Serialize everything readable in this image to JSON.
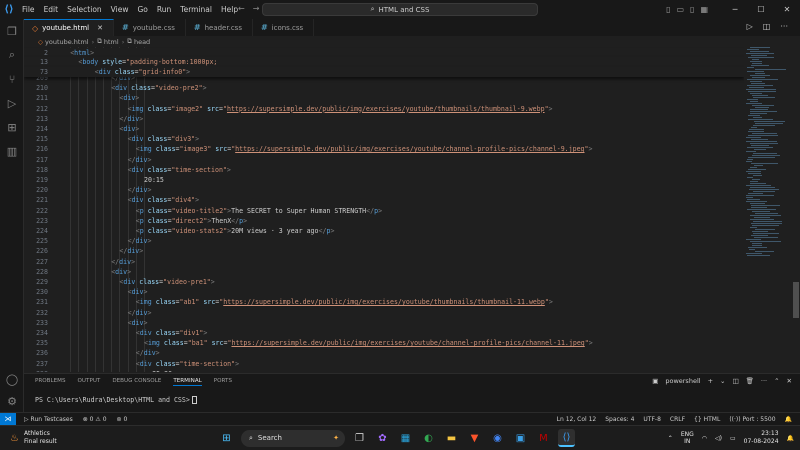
{
  "window": {
    "menu": [
      "File",
      "Edit",
      "Selection",
      "View",
      "Go",
      "Run",
      "Terminal",
      "Help"
    ],
    "search_text": "HTML and CSS"
  },
  "tabs": [
    {
      "label": "youtube.html",
      "type": "html",
      "active": true
    },
    {
      "label": "youtube.css",
      "type": "css",
      "active": false
    },
    {
      "label": "header.css",
      "type": "css",
      "active": false
    },
    {
      "label": "icons.css",
      "type": "css",
      "active": false
    }
  ],
  "breadcrumb": [
    "youtube.html",
    "html",
    "head"
  ],
  "editor": {
    "sticky_lines": [
      {
        "n": "2",
        "indent": 1,
        "tokens": [
          [
            "br",
            "<"
          ],
          [
            "tg",
            "html"
          ],
          [
            "br",
            ">"
          ]
        ]
      },
      {
        "n": "13",
        "indent": 2,
        "tokens": [
          [
            "br",
            "<"
          ],
          [
            "tg",
            "body"
          ],
          [
            "tx",
            " "
          ],
          [
            "at",
            "style"
          ],
          [
            "tx",
            "="
          ],
          [
            "st",
            "\"padding-bottom:1000px;"
          ]
        ]
      },
      {
        "n": "73",
        "indent": 4,
        "tokens": [
          [
            "br",
            "<"
          ],
          [
            "tg",
            "div"
          ],
          [
            "tx",
            " "
          ],
          [
            "at",
            "class"
          ],
          [
            "tx",
            "="
          ],
          [
            "st",
            "\"grid-info0\""
          ],
          [
            "br",
            ">"
          ]
        ]
      }
    ],
    "lines": [
      {
        "n": "209",
        "indent": 6,
        "tokens": [
          [
            "br",
            "</"
          ],
          [
            "tg",
            "div"
          ],
          [
            "br",
            ">"
          ]
        ]
      },
      {
        "n": "210",
        "indent": 6,
        "tokens": [
          [
            "br",
            "<"
          ],
          [
            "tg",
            "div"
          ],
          [
            "tx",
            " "
          ],
          [
            "at",
            "class"
          ],
          [
            "tx",
            "="
          ],
          [
            "st",
            "\"video-pre2\""
          ],
          [
            "br",
            ">"
          ]
        ]
      },
      {
        "n": "211",
        "indent": 7,
        "tokens": [
          [
            "br",
            "<"
          ],
          [
            "tg",
            "div"
          ],
          [
            "br",
            ">"
          ]
        ]
      },
      {
        "n": "212",
        "indent": 8,
        "tokens": [
          [
            "br",
            "<"
          ],
          [
            "tg",
            "img"
          ],
          [
            "tx",
            " "
          ],
          [
            "at",
            "class"
          ],
          [
            "tx",
            "="
          ],
          [
            "st",
            "\"image2\""
          ],
          [
            "tx",
            " "
          ],
          [
            "at",
            "src"
          ],
          [
            "tx",
            "="
          ],
          [
            "st",
            "\""
          ],
          [
            "stu",
            "https://supersimple.dev/public/img/exercises/youtube/thumbnails/thumbnail-9.webp"
          ],
          [
            "st",
            "\""
          ],
          [
            "br",
            ">"
          ]
        ]
      },
      {
        "n": "213",
        "indent": 7,
        "tokens": [
          [
            "br",
            "</"
          ],
          [
            "tg",
            "div"
          ],
          [
            "br",
            ">"
          ]
        ]
      },
      {
        "n": "214",
        "indent": 7,
        "tokens": [
          [
            "br",
            "<"
          ],
          [
            "tg",
            "div"
          ],
          [
            "br",
            ">"
          ]
        ]
      },
      {
        "n": "215",
        "indent": 8,
        "tokens": [
          [
            "br",
            "<"
          ],
          [
            "tg",
            "div"
          ],
          [
            "tx",
            " "
          ],
          [
            "at",
            "class"
          ],
          [
            "tx",
            "="
          ],
          [
            "st",
            "\"div3\""
          ],
          [
            "br",
            ">"
          ]
        ]
      },
      {
        "n": "216",
        "indent": 9,
        "tokens": [
          [
            "br",
            "<"
          ],
          [
            "tg",
            "img"
          ],
          [
            "tx",
            " "
          ],
          [
            "at",
            "class"
          ],
          [
            "tx",
            "="
          ],
          [
            "st",
            "\"image3\""
          ],
          [
            "tx",
            " "
          ],
          [
            "at",
            "src"
          ],
          [
            "tx",
            "="
          ],
          [
            "st",
            "\""
          ],
          [
            "stu",
            "https://supersimple.dev/public/img/exercises/youtube/channel-profile-pics/channel-9.jpeg"
          ],
          [
            "st",
            "\""
          ],
          [
            "br",
            ">"
          ]
        ]
      },
      {
        "n": "217",
        "indent": 8,
        "tokens": [
          [
            "br",
            "</"
          ],
          [
            "tg",
            "div"
          ],
          [
            "br",
            ">"
          ]
        ]
      },
      {
        "n": "218",
        "indent": 8,
        "tokens": [
          [
            "br",
            "<"
          ],
          [
            "tg",
            "div"
          ],
          [
            "tx",
            " "
          ],
          [
            "at",
            "class"
          ],
          [
            "tx",
            "="
          ],
          [
            "st",
            "\"time-section\""
          ],
          [
            "br",
            ">"
          ]
        ]
      },
      {
        "n": "219",
        "indent": 10,
        "tokens": [
          [
            "tx",
            "20:15"
          ]
        ]
      },
      {
        "n": "220",
        "indent": 8,
        "tokens": [
          [
            "br",
            "</"
          ],
          [
            "tg",
            "div"
          ],
          [
            "br",
            ">"
          ]
        ]
      },
      {
        "n": "221",
        "indent": 8,
        "tokens": [
          [
            "br",
            "<"
          ],
          [
            "tg",
            "div"
          ],
          [
            "tx",
            " "
          ],
          [
            "at",
            "class"
          ],
          [
            "tx",
            "="
          ],
          [
            "st",
            "\"div4\""
          ],
          [
            "br",
            ">"
          ]
        ]
      },
      {
        "n": "222",
        "indent": 9,
        "tokens": [
          [
            "br",
            "<"
          ],
          [
            "tg",
            "p"
          ],
          [
            "tx",
            " "
          ],
          [
            "at",
            "class"
          ],
          [
            "tx",
            "="
          ],
          [
            "st",
            "\"video-title2\""
          ],
          [
            "br",
            ">"
          ],
          [
            "tx",
            "The SECRET to Super Human STRENGTH"
          ],
          [
            "br",
            "</"
          ],
          [
            "tg",
            "p"
          ],
          [
            "br",
            ">"
          ]
        ]
      },
      {
        "n": "223",
        "indent": 9,
        "tokens": [
          [
            "br",
            "<"
          ],
          [
            "tg",
            "p"
          ],
          [
            "tx",
            " "
          ],
          [
            "at",
            "class"
          ],
          [
            "tx",
            "="
          ],
          [
            "st",
            "\"direct2\""
          ],
          [
            "br",
            ">"
          ],
          [
            "tx",
            "ThenX"
          ],
          [
            "br",
            "</"
          ],
          [
            "tg",
            "p"
          ],
          [
            "br",
            ">"
          ]
        ]
      },
      {
        "n": "224",
        "indent": 9,
        "tokens": [
          [
            "br",
            "<"
          ],
          [
            "tg",
            "p"
          ],
          [
            "tx",
            " "
          ],
          [
            "at",
            "class"
          ],
          [
            "tx",
            "="
          ],
          [
            "st",
            "\"video-stats2\""
          ],
          [
            "br",
            ">"
          ],
          [
            "tx",
            "20M views · 3 year ago"
          ],
          [
            "br",
            "</"
          ],
          [
            "tg",
            "p"
          ],
          [
            "br",
            ">"
          ]
        ]
      },
      {
        "n": "225",
        "indent": 8,
        "tokens": [
          [
            "br",
            "</"
          ],
          [
            "tg",
            "div"
          ],
          [
            "br",
            ">"
          ]
        ]
      },
      {
        "n": "226",
        "indent": 7,
        "tokens": [
          [
            "br",
            "</"
          ],
          [
            "tg",
            "div"
          ],
          [
            "br",
            ">"
          ]
        ]
      },
      {
        "n": "227",
        "indent": 6,
        "tokens": [
          [
            "br",
            "</"
          ],
          [
            "tg",
            "div"
          ],
          [
            "br",
            ">"
          ]
        ]
      },
      {
        "n": "228",
        "indent": 6,
        "tokens": [
          [
            "br",
            "<"
          ],
          [
            "tg",
            "div"
          ],
          [
            "br",
            ">"
          ]
        ]
      },
      {
        "n": "229",
        "indent": 7,
        "tokens": [
          [
            "br",
            "<"
          ],
          [
            "tg",
            "div"
          ],
          [
            "tx",
            " "
          ],
          [
            "at",
            "class"
          ],
          [
            "tx",
            "="
          ],
          [
            "st",
            "\"video-pre1\""
          ],
          [
            "br",
            ">"
          ]
        ]
      },
      {
        "n": "230",
        "indent": 8,
        "tokens": [
          [
            "br",
            "<"
          ],
          [
            "tg",
            "div"
          ],
          [
            "br",
            ">"
          ]
        ]
      },
      {
        "n": "231",
        "indent": 9,
        "tokens": [
          [
            "br",
            "<"
          ],
          [
            "tg",
            "img"
          ],
          [
            "tx",
            " "
          ],
          [
            "at",
            "class"
          ],
          [
            "tx",
            "="
          ],
          [
            "st",
            "\"ab1\""
          ],
          [
            "tx",
            " "
          ],
          [
            "at",
            "src"
          ],
          [
            "tx",
            "="
          ],
          [
            "st",
            "\""
          ],
          [
            "stu",
            "https://supersimple.dev/public/img/exercises/youtube/thumbnails/thumbnail-11.webp"
          ],
          [
            "st",
            "\""
          ],
          [
            "br",
            ">"
          ]
        ]
      },
      {
        "n": "232",
        "indent": 8,
        "tokens": [
          [
            "br",
            "</"
          ],
          [
            "tg",
            "div"
          ],
          [
            "br",
            ">"
          ]
        ]
      },
      {
        "n": "233",
        "indent": 8,
        "tokens": [
          [
            "br",
            "<"
          ],
          [
            "tg",
            "div"
          ],
          [
            "br",
            ">"
          ]
        ]
      },
      {
        "n": "234",
        "indent": 9,
        "tokens": [
          [
            "br",
            "<"
          ],
          [
            "tg",
            "div"
          ],
          [
            "tx",
            " "
          ],
          [
            "at",
            "class"
          ],
          [
            "tx",
            "="
          ],
          [
            "st",
            "\"div1\""
          ],
          [
            "br",
            ">"
          ]
        ]
      },
      {
        "n": "235",
        "indent": 10,
        "tokens": [
          [
            "br",
            "<"
          ],
          [
            "tg",
            "img"
          ],
          [
            "tx",
            " "
          ],
          [
            "at",
            "class"
          ],
          [
            "tx",
            "="
          ],
          [
            "st",
            "\"ba1\""
          ],
          [
            "tx",
            " "
          ],
          [
            "at",
            "src"
          ],
          [
            "tx",
            "="
          ],
          [
            "st",
            "\""
          ],
          [
            "stu",
            "https://supersimple.dev/public/img/exercises/youtube/channel-profile-pics/channel-11.jpeg"
          ],
          [
            "st",
            "\""
          ],
          [
            "br",
            ">"
          ]
        ]
      },
      {
        "n": "236",
        "indent": 9,
        "tokens": [
          [
            "br",
            "</"
          ],
          [
            "tg",
            "div"
          ],
          [
            "br",
            ">"
          ]
        ]
      },
      {
        "n": "237",
        "indent": 9,
        "tokens": [
          [
            "br",
            "<"
          ],
          [
            "tg",
            "div"
          ],
          [
            "tx",
            " "
          ],
          [
            "at",
            "class"
          ],
          [
            "tx",
            "="
          ],
          [
            "st",
            "\"time-section\""
          ],
          [
            "br",
            ">"
          ]
        ]
      },
      {
        "n": "238",
        "indent": 11,
        "tokens": [
          [
            "tx",
            "25:30"
          ]
        ]
      }
    ]
  },
  "panel": {
    "tabs": [
      "PROBLEMS",
      "OUTPUT",
      "DEBUG CONSOLE",
      "TERMINAL",
      "PORTS"
    ],
    "active_tab": "TERMINAL",
    "shell": "powershell",
    "prompt": "PS C:\\Users\\Rudra\\Desktop\\HTML and CSS>"
  },
  "statusbar": {
    "run_testcases": "Run Testcases",
    "errors": "0",
    "warnings": "0",
    "ports": "0",
    "position": "Ln 12, Col 12",
    "spaces": "Spaces: 4",
    "encoding": "UTF-8",
    "eol": "CRLF",
    "language": "HTML",
    "port": "Port : 5500"
  },
  "taskbar": {
    "weather_title": "Athletics",
    "weather_sub": "Final result",
    "search_label": "Search",
    "lang_top": "ENG",
    "lang_bottom": "IN",
    "time": "23:13",
    "date": "07-08-2024"
  },
  "colors": {
    "accent": "#0078d4",
    "tag": "#569cd6",
    "attribute": "#9cdcfe",
    "string": "#ce9178"
  }
}
